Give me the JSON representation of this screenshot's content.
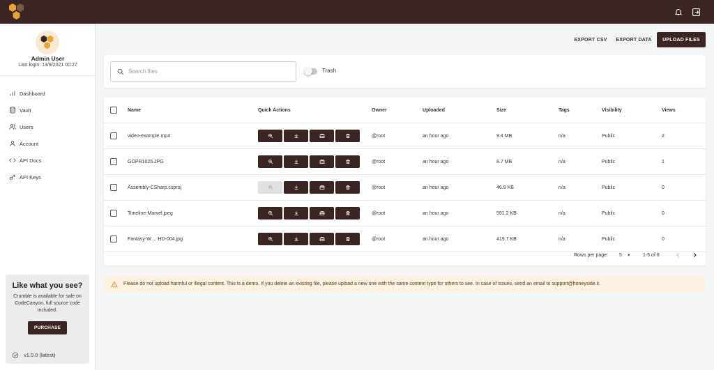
{
  "sidebar": {
    "user_name": "Admin User",
    "last_login": "Last login: 13/9/2021 00:27",
    "nav": [
      {
        "label": "Dashboard",
        "icon": "dashboard-icon"
      },
      {
        "label": "Vault",
        "icon": "vault-icon"
      },
      {
        "label": "Users",
        "icon": "users-icon"
      },
      {
        "label": "Account",
        "icon": "account-icon"
      },
      {
        "label": "API Docs",
        "icon": "api-docs-icon"
      },
      {
        "label": "API Keys",
        "icon": "api-keys-icon"
      }
    ],
    "promo": {
      "title": "Like what you see?",
      "text": "Crumble is available for sale on CodeCanyon, full source code included.",
      "button": "PURCHASE"
    },
    "version": "v1.0.0 (latest)"
  },
  "actions": {
    "export_csv": "EXPORT CSV",
    "export_data": "EXPORT DATA",
    "upload": "UPLOAD FILES"
  },
  "search": {
    "placeholder": "Search files",
    "trash_label": "Trash"
  },
  "table": {
    "headers": {
      "name": "Name",
      "quick_actions": "Quick Actions",
      "owner": "Owner",
      "uploaded": "Uploaded",
      "size": "Size",
      "tags": "Tags",
      "visibility": "Visibility",
      "views": "Views"
    },
    "rows": [
      {
        "name": "video-example.mp4",
        "owner": "@root",
        "uploaded": "an hour ago",
        "size": "9.4 MB",
        "tags": "n/a",
        "visibility": "Public",
        "views": "2",
        "preview_enabled": true
      },
      {
        "name": "GOPR1025.JPG",
        "owner": "@root",
        "uploaded": "an hour ago",
        "size": "8.7 MB",
        "tags": "n/a",
        "visibility": "Public",
        "views": "1",
        "preview_enabled": true
      },
      {
        "name": "Assembly-CSharp.csproj",
        "owner": "@root",
        "uploaded": "an hour ago",
        "size": "46.9 KB",
        "tags": "n/a",
        "visibility": "Public",
        "views": "0",
        "preview_enabled": false
      },
      {
        "name": "Timeline-Marvel.jpeg",
        "owner": "@root",
        "uploaded": "an hour ago",
        "size": "551.2 KB",
        "tags": "n/a",
        "visibility": "Public",
        "views": "0",
        "preview_enabled": true
      },
      {
        "name": "Fantasy-W ... HD-004.jpg",
        "owner": "@root",
        "uploaded": "an hour ago",
        "size": "419.7 KB",
        "tags": "n/a",
        "visibility": "Public",
        "views": "0",
        "preview_enabled": true
      }
    ],
    "pagination": {
      "rows_per_page_label": "Rows per page:",
      "rows_per_page": "5",
      "range": "1-5 of 8"
    }
  },
  "notice": "Please do not upload harmful or illegal content. This is a demo. If you delete an existing file, please upload a new one with the same content type for others to see. In case of issues, send an email to support@honeyside.it.",
  "colors": {
    "brand_dark": "#3a2523",
    "honey": "#e8a23a",
    "notice_bg": "#fdf1e3"
  }
}
